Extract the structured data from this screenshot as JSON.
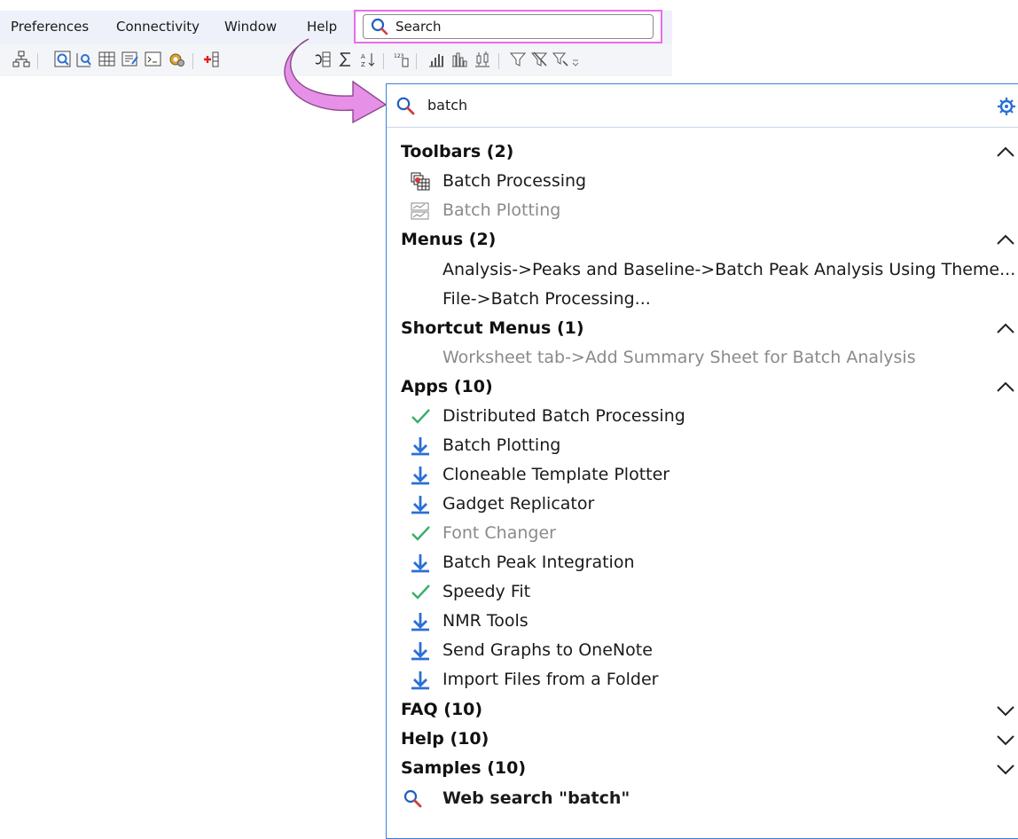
{
  "menubar": {
    "items": [
      {
        "label": "Preferences"
      },
      {
        "label": "Connectivity"
      },
      {
        "label": "Window"
      },
      {
        "label": "Help"
      }
    ],
    "search_label": "Search"
  },
  "panel": {
    "query": "batch",
    "sections": [
      {
        "title": "Toolbars (2)",
        "expanded": true,
        "items": [
          {
            "label": "Batch Processing",
            "icon": "batch-processing-icon",
            "dim": false
          },
          {
            "label": "Batch Plotting",
            "icon": "batch-plotting-icon",
            "dim": true
          }
        ]
      },
      {
        "title": "Menus (2)",
        "expanded": true,
        "items": [
          {
            "label": "Analysis->Peaks and Baseline->Batch Peak Analysis Using Theme...",
            "dim": false
          },
          {
            "label": "File->Batch Processing...",
            "dim": false
          }
        ]
      },
      {
        "title": "Shortcut Menus (1)",
        "expanded": true,
        "items": [
          {
            "label": "Worksheet tab->Add Summary Sheet for Batch Analysis",
            "dim": true
          }
        ]
      },
      {
        "title": "Apps (10)",
        "expanded": true,
        "items": [
          {
            "label": "Distributed Batch Processing",
            "icon": "installed-check-icon",
            "dim": false
          },
          {
            "label": "Batch Plotting",
            "icon": "download-icon",
            "dim": false
          },
          {
            "label": "Cloneable Template Plotter",
            "icon": "download-icon",
            "dim": false
          },
          {
            "label": "Gadget Replicator",
            "icon": "download-icon",
            "dim": false
          },
          {
            "label": "Font Changer",
            "icon": "installed-check-icon",
            "dim": true
          },
          {
            "label": "Batch Peak Integration",
            "icon": "download-icon",
            "dim": false
          },
          {
            "label": "Speedy Fit",
            "icon": "installed-check-icon",
            "dim": false
          },
          {
            "label": "NMR Tools",
            "icon": "download-icon",
            "dim": false
          },
          {
            "label": "Send Graphs to OneNote",
            "icon": "download-icon",
            "dim": false
          },
          {
            "label": "Import Files from a Folder",
            "icon": "download-icon",
            "dim": false
          }
        ]
      },
      {
        "title": "FAQ (10)",
        "expanded": false,
        "items": []
      },
      {
        "title": "Help (10)",
        "expanded": false,
        "items": []
      },
      {
        "title": "Samples (10)",
        "expanded": false,
        "items": []
      }
    ],
    "web_search": "Web search \"batch\""
  },
  "colors": {
    "highlight_border": "#e86ee6",
    "panel_border": "#3a7fd9",
    "check": "#3aae6a",
    "download": "#2a6fd6",
    "search_icon_red": "#e04040"
  }
}
